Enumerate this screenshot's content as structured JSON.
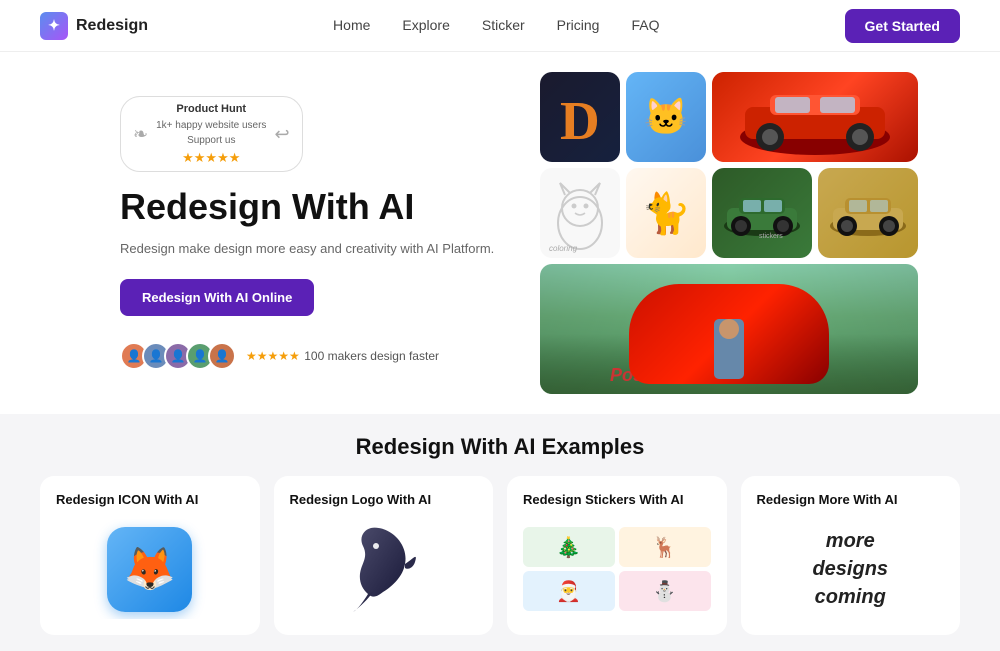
{
  "navbar": {
    "brand": "Redesign",
    "links": [
      "Home",
      "Explore",
      "Sticker",
      "Pricing",
      "FAQ"
    ],
    "cta": "Get Started"
  },
  "hero": {
    "badge": {
      "platform": "Product Hunt",
      "users": "1k+ happy website users",
      "support": "Support us",
      "stars": "★★★★★"
    },
    "title": "Redesign With AI",
    "subtitle": "Redesign make design more easy and creativity with AI Platform.",
    "cta": "Redesign With AI Online",
    "proof_stars": "★★★★★",
    "proof_text": "100 makers design faster"
  },
  "examples": {
    "section_title": "Redesign With AI Examples",
    "cards": [
      {
        "title": "Redesign ICON With AI"
      },
      {
        "title": "Redesign Logo With AI"
      },
      {
        "title": "Redesign Stickers With AI"
      },
      {
        "title": "Redesign More With AI"
      }
    ],
    "more_designs": "more\ndesigns\ncoming"
  }
}
